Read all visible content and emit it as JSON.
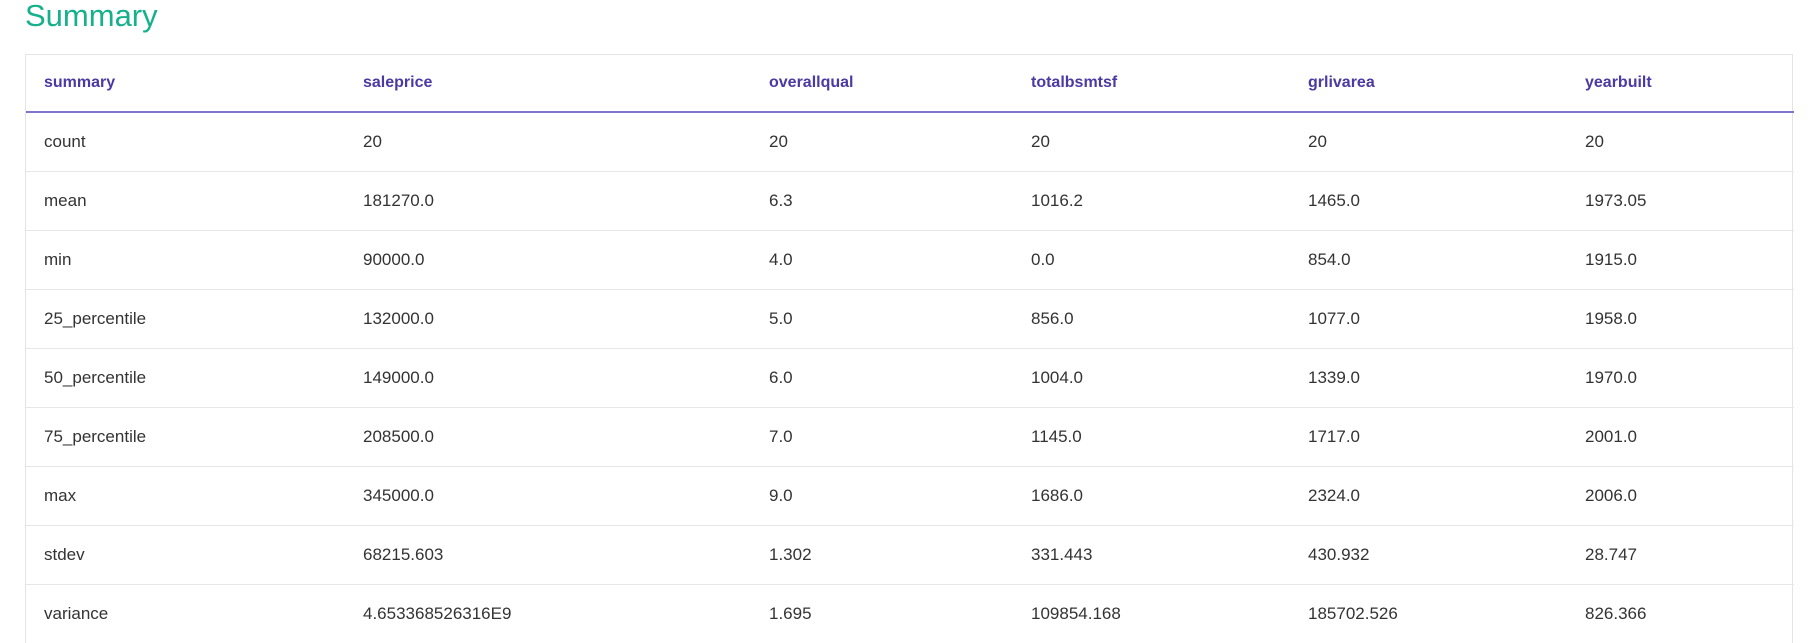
{
  "section": {
    "title": "Summary"
  },
  "table": {
    "columns": [
      "summary",
      "saleprice",
      "overallqual",
      "totalbsmtsf",
      "grlivarea",
      "yearbuilt"
    ],
    "rows": [
      [
        "count",
        "20",
        "20",
        "20",
        "20",
        "20"
      ],
      [
        "mean",
        "181270.0",
        "6.3",
        "1016.2",
        "1465.0",
        "1973.05"
      ],
      [
        "min",
        "90000.0",
        "4.0",
        "0.0",
        "854.0",
        "1915.0"
      ],
      [
        "25_percentile",
        "132000.0",
        "5.0",
        "856.0",
        "1077.0",
        "1958.0"
      ],
      [
        "50_percentile",
        "149000.0",
        "6.0",
        "1004.0",
        "1339.0",
        "1970.0"
      ],
      [
        "75_percentile",
        "208500.0",
        "7.0",
        "1145.0",
        "1717.0",
        "2001.0"
      ],
      [
        "max",
        "345000.0",
        "9.0",
        "1686.0",
        "2324.0",
        "2006.0"
      ],
      [
        "stdev",
        "68215.603",
        "1.302",
        "331.443",
        "430.932",
        "28.747"
      ],
      [
        "variance",
        "4.653368526316E9",
        "1.695",
        "109854.168",
        "185702.526",
        "826.366"
      ]
    ]
  },
  "colors": {
    "title": "#16b08c",
    "header_text": "#4a3aa3",
    "header_rule": "#7f75cc"
  }
}
